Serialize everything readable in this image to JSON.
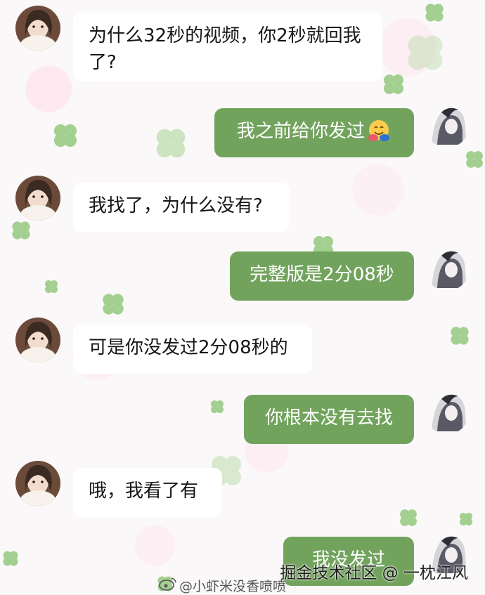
{
  "chat": {
    "messages": [
      {
        "side": "in",
        "text_line1": "为什么32秒的视频，你2秒就回我",
        "text_line2": "了?"
      },
      {
        "side": "out",
        "text": "我之前给你发过",
        "emoji": "hugging-emoji"
      },
      {
        "side": "in",
        "text": "我找了，为什么没有?"
      },
      {
        "side": "out",
        "text": "完整版是2分08秒"
      },
      {
        "side": "in",
        "text": "可是你没发过2分08秒的"
      },
      {
        "side": "out",
        "text": "你根本没有去找"
      },
      {
        "side": "in",
        "text": "哦，我看了有"
      },
      {
        "side": "out",
        "text": "我没发过"
      }
    ]
  },
  "watermark": {
    "site": "掘金技术社区 @ 一枕江风",
    "user": "@小虾米没香喷喷",
    "icon": "weibo-icon"
  },
  "colors": {
    "outgoing_bubble": "#72a35d",
    "incoming_bubble": "#ffffff",
    "clover": "#8ec778"
  }
}
